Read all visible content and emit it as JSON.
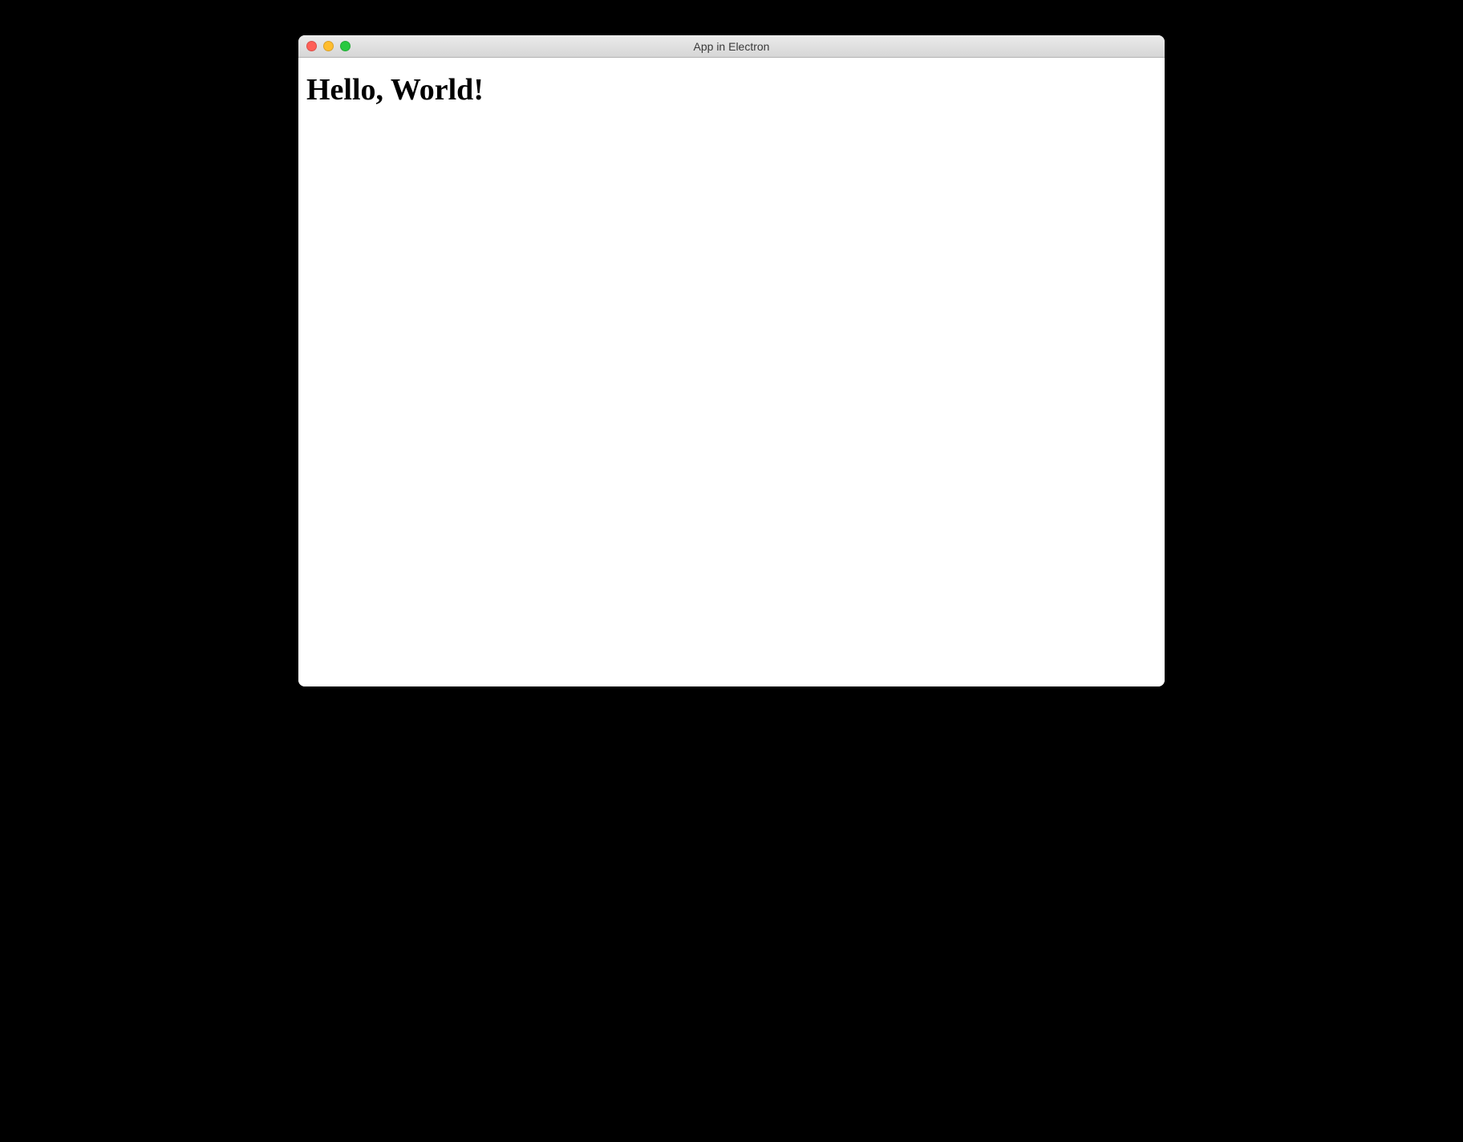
{
  "window": {
    "title": "App in Electron"
  },
  "content": {
    "heading": "Hello, World!"
  }
}
